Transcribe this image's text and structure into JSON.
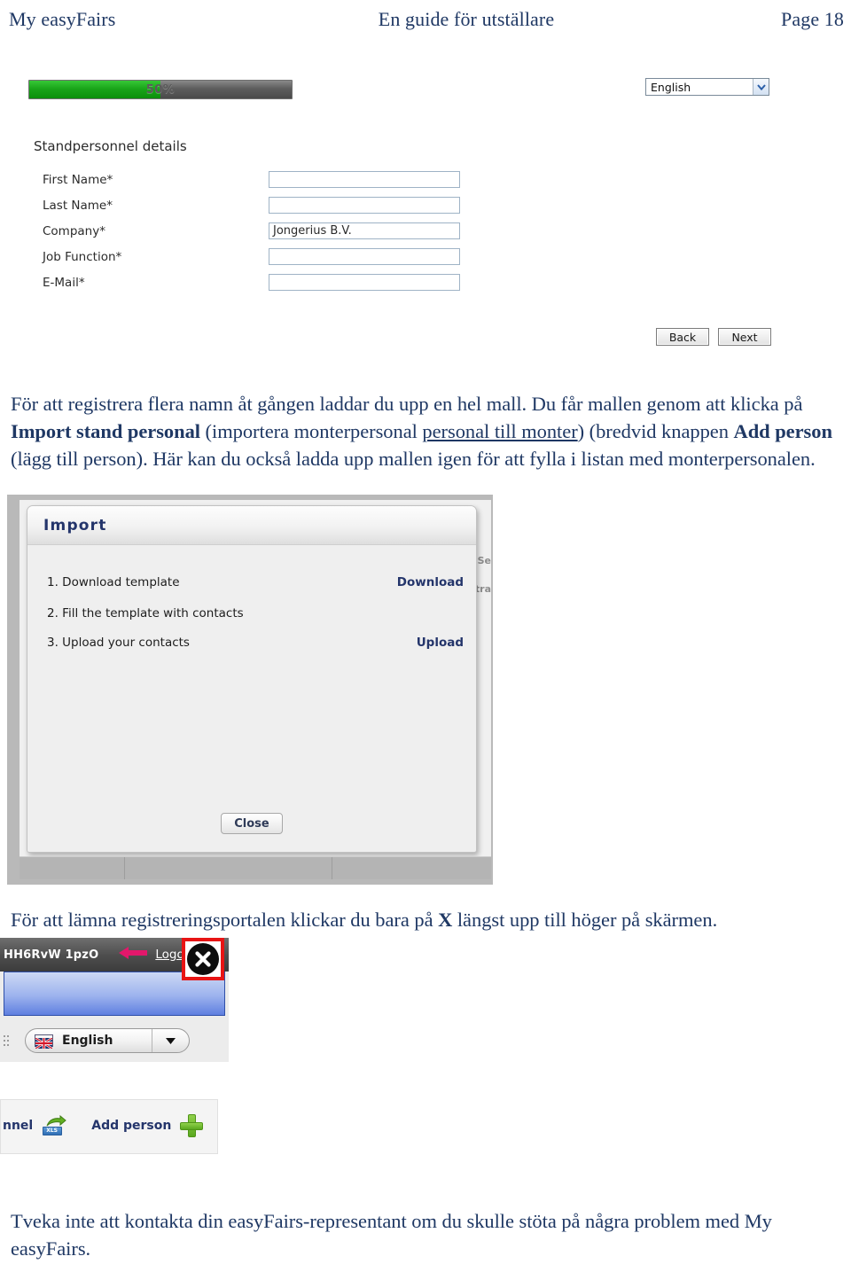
{
  "header": {
    "left": "My easyFairs",
    "center": "En guide för utställare",
    "right": "Page 18"
  },
  "form_screenshot": {
    "progress": {
      "label": "50%",
      "percent": 50,
      "fill_color": "#18a318",
      "track_color": "#4a4a4a"
    },
    "language_select": {
      "value": "English",
      "icon": "chevron-down-icon"
    },
    "section_title": "Standpersonnel details",
    "fields": [
      {
        "label": "First Name*",
        "value": ""
      },
      {
        "label": "Last Name*",
        "value": ""
      },
      {
        "label": "Company*",
        "value": "Jongerius B.V."
      },
      {
        "label": "Job Function*",
        "value": ""
      },
      {
        "label": "E-Mail*",
        "value": ""
      }
    ],
    "buttons": {
      "back": "Back",
      "next": "Next"
    }
  },
  "paragraph_1": {
    "part1": "För att registrera flera namn åt gången laddar du upp en hel mall. Du får mallen genom att klicka på ",
    "bold1": "Import stand personal",
    "part2": " (importera monterpersonal ",
    "underline1": "personal till monter",
    "part3": ") (bredvid knappen ",
    "bold2": "Add person",
    "part4": " (lägg till person). Här kan du också ladda upp mallen igen för att fylla i listan med monterpersonalen."
  },
  "import_screenshot": {
    "dialog_title": "Import",
    "steps": [
      {
        "text": "1. Download template",
        "action": "Download"
      },
      {
        "text": "2. Fill the template with contacts",
        "action": ""
      },
      {
        "text": "3. Upload your contacts",
        "action": "Upload"
      }
    ],
    "close_button": "Close"
  },
  "paragraph_2": {
    "part1": "För att lämna registreringsportalen klickar du bara på ",
    "bold1": "X",
    "part2": " längst upp till höger på skärmen."
  },
  "logout_screenshot": {
    "session_id": "HH6RvW 1pzO",
    "logout_link": "Logout",
    "arrow_icon": "left-arrow-icon",
    "arrow_color": "#e3176b",
    "annotation": {
      "icon": "close-x-circle-icon",
      "border_color": "#e81414"
    },
    "language_pill": {
      "value": "English",
      "flag": "uk-flag-icon",
      "icon": "triangle-down-icon"
    }
  },
  "addperson_screenshot": {
    "import_label": "nnel",
    "import_icon": "xls-export-icon",
    "add_label": "Add person",
    "add_icon": "green-plus-icon"
  },
  "footer_paragraph": "Tveka inte att kontakta din easyFairs-representant om du skulle stöta på några problem med My easyFairs."
}
